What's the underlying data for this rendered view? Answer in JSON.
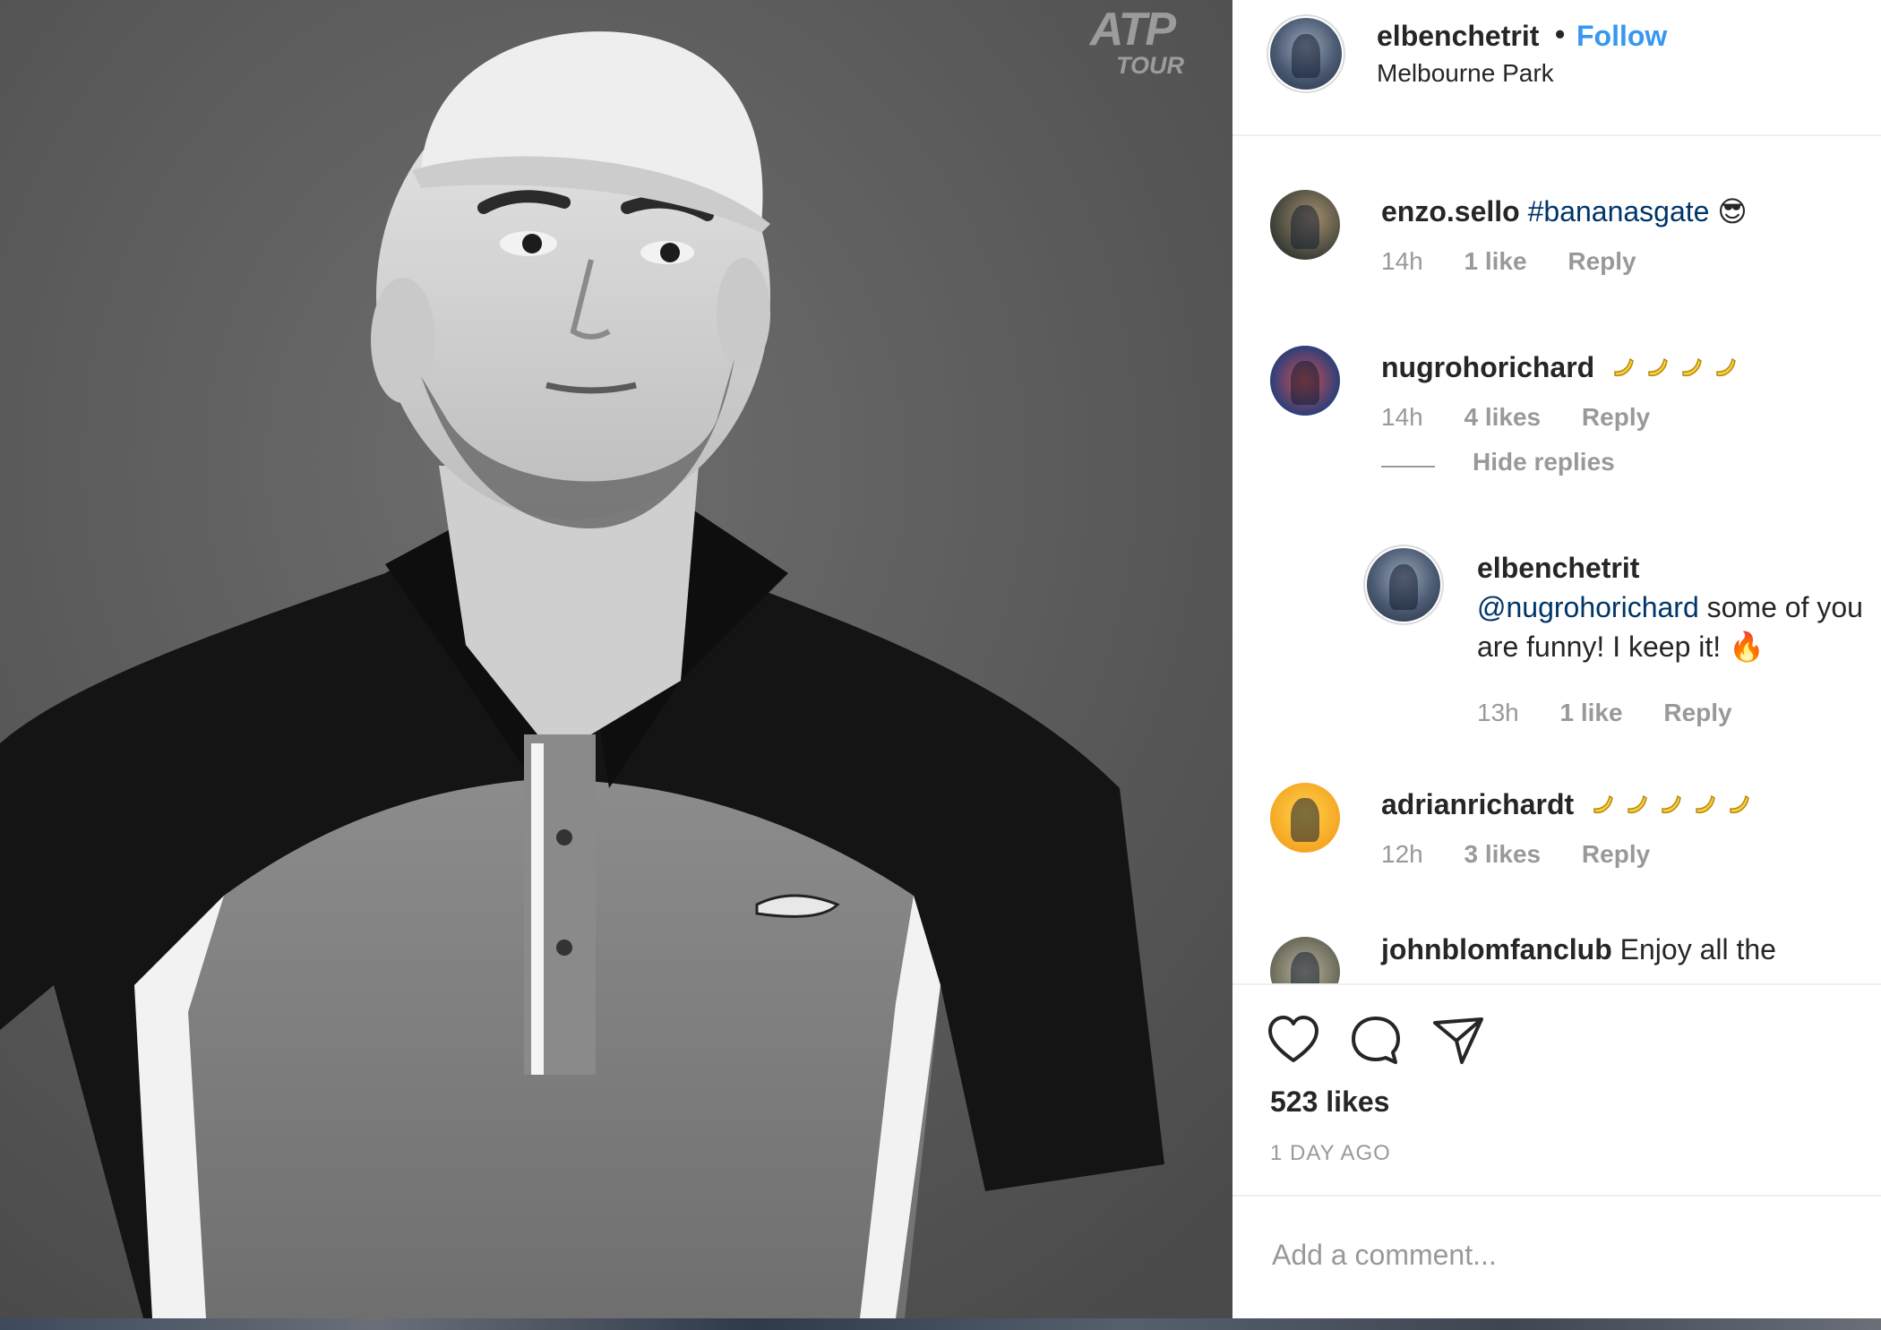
{
  "post": {
    "watermark": {
      "top": "ATP",
      "bottom": "TOUR"
    },
    "author": {
      "username": "elbenchetrit",
      "separator": "•",
      "follow_label": "Follow",
      "location": "Melbourne Park"
    }
  },
  "comments": [
    {
      "username": "enzo.sello",
      "text": "#bananasgate",
      "emoji": "😎",
      "time": "14h",
      "likes": "1 like",
      "reply": "Reply"
    },
    {
      "username": "nugrohorichard",
      "banana_count": 4,
      "time": "14h",
      "likes": "4 likes",
      "reply": "Reply",
      "hide_replies": "Hide replies"
    },
    {
      "username": "elbenchetrit",
      "mention": "@nugrohorichard",
      "text_line1": " some of you",
      "text_line2": "are funny! I keep it!",
      "emoji": "🔥",
      "time": "13h",
      "likes": "1 like",
      "reply": "Reply"
    },
    {
      "username": "adrianrichardt",
      "banana_count": 5,
      "time": "12h",
      "likes": "3 likes",
      "reply": "Reply"
    },
    {
      "username": "johnblomfanclub",
      "text": " Enjoy all the"
    }
  ],
  "actions": {
    "icons": [
      "heart-icon",
      "comment-icon",
      "share-icon"
    ],
    "likes": "523 likes",
    "posted": "1 DAY AGO"
  },
  "add_comment": {
    "placeholder": "Add a comment..."
  },
  "colors": {
    "link": "#3897f0",
    "hashtag": "#003569",
    "muted": "#999999",
    "text": "#262626",
    "border": "#efefef"
  }
}
